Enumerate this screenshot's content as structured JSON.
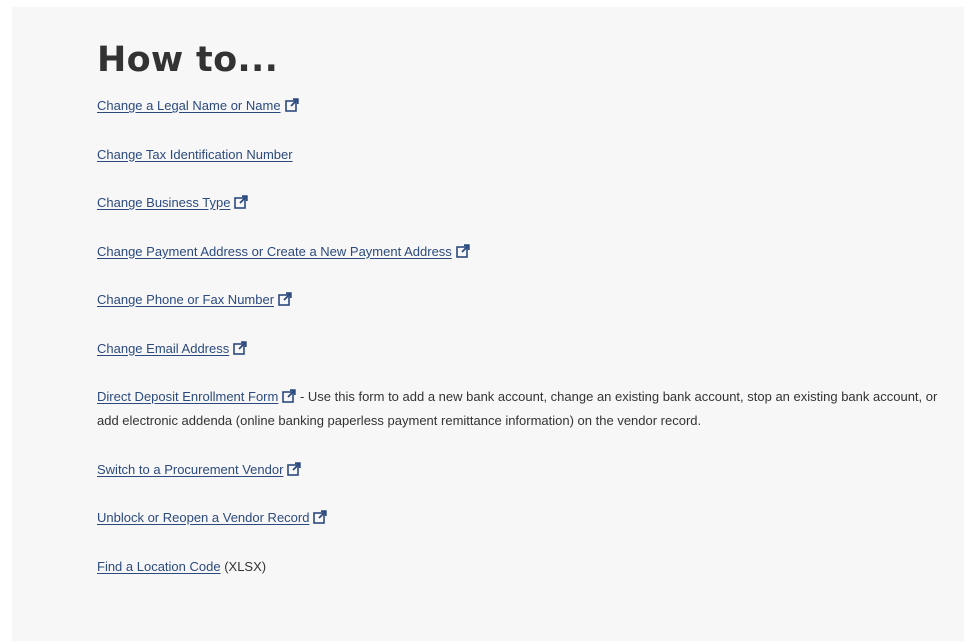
{
  "heading": "How to...",
  "items": [
    {
      "link": "Change a Legal Name or Name",
      "icon": "external-link-icon",
      "suffix": ""
    },
    {
      "link": "Change Tax Identification Number",
      "icon": "",
      "suffix": ""
    },
    {
      "link": "Change Business Type",
      "icon": "external-link-icon",
      "suffix": ""
    },
    {
      "link": "Change Payment Address or Create a New Payment Address",
      "icon": "external-link-icon",
      "suffix": ""
    },
    {
      "link": "Change Phone or Fax Number",
      "icon": "external-link-icon",
      "suffix": ""
    },
    {
      "link": "Change Email Address",
      "icon": "external-link-icon",
      "suffix": ""
    },
    {
      "link": "Direct Deposit Enrollment Form",
      "icon": "external-link-icon",
      "suffix": " - Use this form to add a new bank account, change an existing bank account, stop an existing bank account, or add electronic addenda (online banking paperless payment remittance information) on the vendor record."
    },
    {
      "link": "Switch to a Procurement Vendor",
      "icon": "external-link-icon",
      "suffix": ""
    },
    {
      "link": "Unblock or Reopen a Vendor Record",
      "icon": "external-link-icon",
      "suffix": ""
    },
    {
      "link": "Find a Location Code",
      "icon": "",
      "suffix": " (XLSX)"
    }
  ],
  "colors": {
    "link": "#2c4a7e",
    "text": "#333333",
    "panel": "#f7f7f7"
  }
}
